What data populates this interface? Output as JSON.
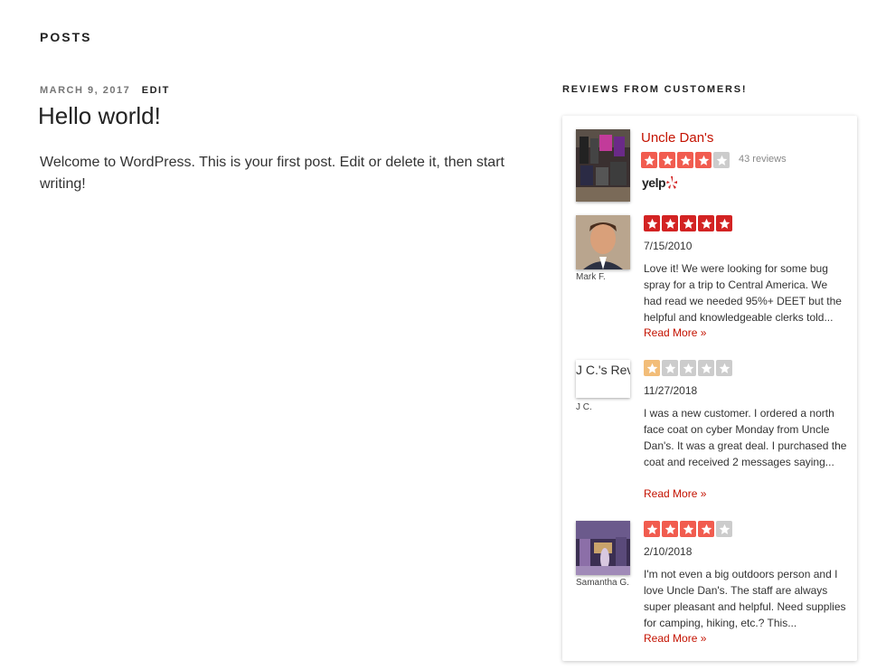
{
  "page": {
    "heading": "POSTS"
  },
  "post": {
    "date": "MARCH 9, 2017",
    "edit_label": "EDIT",
    "title": "Hello world!",
    "content": "Welcome to WordPress. This is your first post. Edit or delete it, then start writing!"
  },
  "widget": {
    "title": "REVIEWS FROM CUSTOMERS!",
    "business": {
      "name": "Uncle Dan's",
      "rating": 4,
      "review_count": "43 reviews",
      "logo_text": "yelp",
      "colors": {
        "brand": "#c41200",
        "star_high": "#f15c4f",
        "star_high_dark": "#d32323",
        "star_low": "#f2bd79",
        "star_empty": "#cccccc"
      }
    },
    "reviews": [
      {
        "name": "Mark F.",
        "rating": 5,
        "date": "7/15/2010",
        "text": "Love it! We were looking for some bug spray for a trip to Central America. We had read we needed 95%+ DEET but the helpful and knowledgeable clerks told...",
        "read_more": "Read More »"
      },
      {
        "name": "J C.",
        "avatar_alt": "J C.'s Review",
        "rating": 1,
        "date": "11/27/2018",
        "text": "I was a new customer. I ordered a north face coat on cyber Monday from Uncle Dan's. It was a great deal. I purchased the coat and received 2 messages saying...",
        "read_more": "Read More »"
      },
      {
        "name": "Samantha G.",
        "rating": 4,
        "date": "2/10/2018",
        "text": "I'm not even a big outdoors person and I love Uncle Dan's. The staff are always super pleasant and helpful. Need supplies for camping, hiking, etc.? This...",
        "read_more": "Read More »"
      }
    ]
  }
}
